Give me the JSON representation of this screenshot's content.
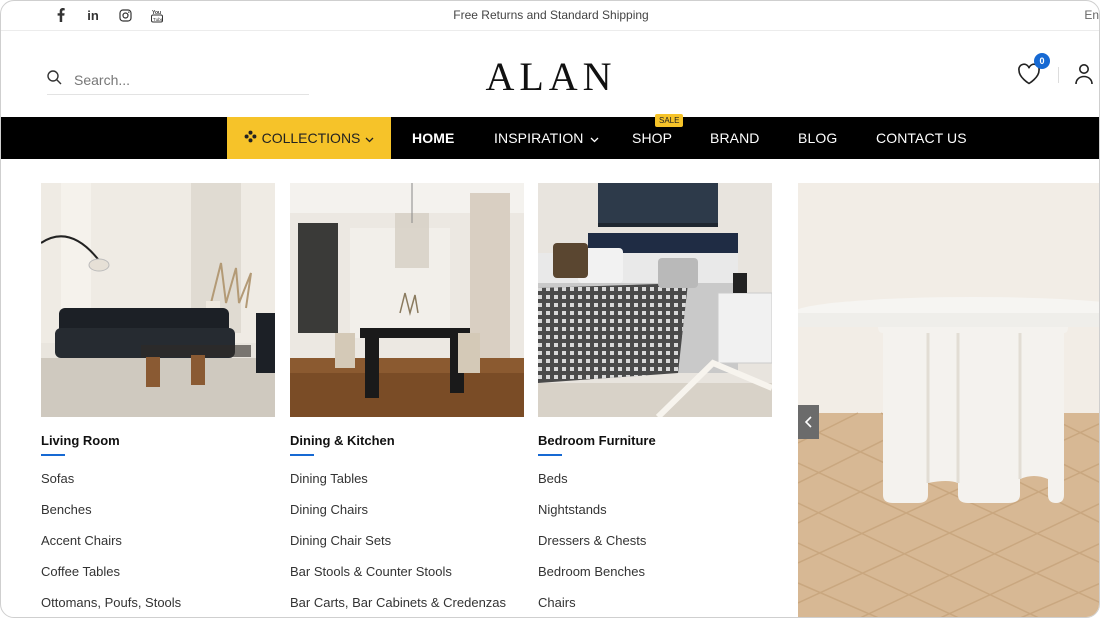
{
  "topbar": {
    "social": [
      "facebook-icon",
      "linkedin-icon",
      "instagram-icon",
      "youtube-icon"
    ],
    "announcement": "Free Returns and Standard Shipping",
    "language": "En"
  },
  "header": {
    "search_placeholder": "Search...",
    "logo": "ALAN",
    "wishlist_count": "0"
  },
  "nav": {
    "collections": "COLLECTIONS",
    "items": [
      "HOME",
      "INSPIRATION",
      "SHOP",
      "BRAND",
      "BLOG",
      "CONTACT US"
    ],
    "sale_badge": "SALE"
  },
  "menu": {
    "columns": [
      {
        "title": "Living Room",
        "links": [
          "Sofas",
          "Benches",
          "Accent Chairs",
          "Coffee Tables",
          "Ottomans, Poufs, Stools"
        ]
      },
      {
        "title": "Dining & Kitchen",
        "links": [
          "Dining Tables",
          "Dining Chairs",
          "Dining Chair Sets",
          "Bar Stools & Counter Stools",
          "Bar Carts, Bar Cabinets & Credenzas"
        ]
      },
      {
        "title": "Bedroom Furniture",
        "links": [
          "Beds",
          "Nightstands",
          "Dressers & Chests",
          "Bedroom Benches",
          "Chairs"
        ]
      }
    ]
  },
  "colors": {
    "accent": "#f6c329",
    "nav_bg": "#000000",
    "link_blue": "#1669d3"
  }
}
